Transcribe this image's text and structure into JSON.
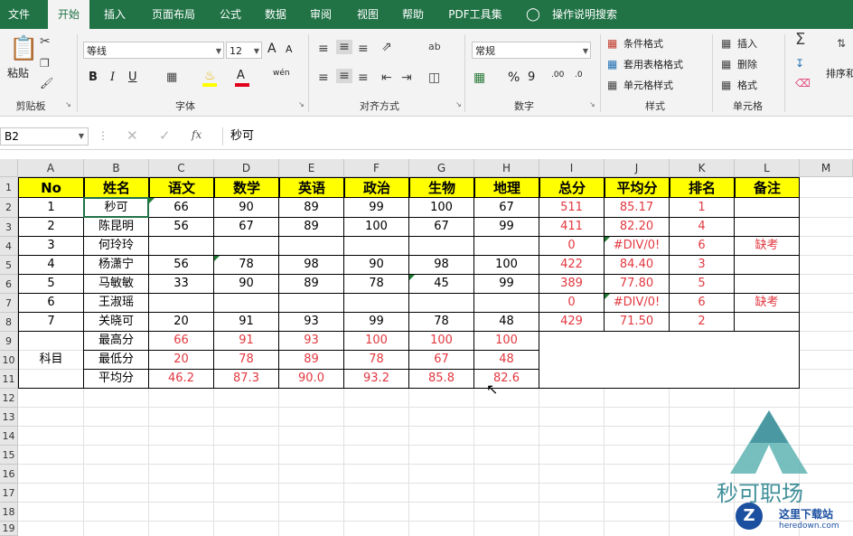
{
  "tabs": [
    {
      "label": "文件",
      "active": false
    },
    {
      "label": "开始",
      "active": true
    },
    {
      "label": "插入",
      "active": false
    },
    {
      "label": "页面布局",
      "active": false
    },
    {
      "label": "公式",
      "active": false
    },
    {
      "label": "数据",
      "active": false
    },
    {
      "label": "审阅",
      "active": false
    },
    {
      "label": "视图",
      "active": false
    },
    {
      "label": "帮助",
      "active": false
    },
    {
      "label": "PDF工具集",
      "active": false
    }
  ],
  "tell_me": "操作说明搜索",
  "ribbon": {
    "clipboard": {
      "label": "剪贴板",
      "paste": "粘贴"
    },
    "font": {
      "label": "字体",
      "font_name": "等线",
      "font_size": "12",
      "bold": "B",
      "italic": "I",
      "underline": "U",
      "grow": "A",
      "shrink": "A",
      "phonetic": "wén"
    },
    "alignment": {
      "label": "对齐方式"
    },
    "number": {
      "label": "数字",
      "format": "常规",
      "percent": "%",
      "comma": "9",
      "inc_decimal": ".00",
      "dec_decimal": ".0"
    },
    "styles": {
      "label": "样式",
      "conditional": "条件格式",
      "table": "套用表格格式",
      "cell_styles": "单元格样式"
    },
    "cells": {
      "label": "单元格",
      "insert": "插入",
      "delete": "删除",
      "format": "格式"
    },
    "editing": {
      "sort": "排序和"
    }
  },
  "formula_bar": {
    "name_box": "B2",
    "fx": "fx",
    "value": "秒可"
  },
  "columns": [
    "A",
    "B",
    "C",
    "D",
    "E",
    "F",
    "G",
    "H",
    "I",
    "J",
    "K",
    "L",
    "M"
  ],
  "rows": [
    "1",
    "2",
    "3",
    "4",
    "5",
    "6",
    "7",
    "8",
    "9",
    "10",
    "11",
    "12",
    "13",
    "14",
    "15",
    "16",
    "17",
    "18",
    "19"
  ],
  "table": {
    "header": [
      "No",
      "姓名",
      "语文",
      "数学",
      "英语",
      "政治",
      "生物",
      "地理",
      "总分",
      "平均分",
      "排名",
      "备注"
    ],
    "students": [
      [
        "1",
        "秒可",
        "66",
        "90",
        "89",
        "99",
        "100",
        "67",
        "511",
        "85.17",
        "1",
        ""
      ],
      [
        "2",
        "陈昆明",
        "56",
        "67",
        "89",
        "100",
        "67",
        "99",
        "411",
        "82.20",
        "4",
        ""
      ],
      [
        "3",
        "何玲玲",
        "",
        "",
        "",
        "",
        "",
        "",
        "0",
        "#DIV/0!",
        "6",
        "缺考"
      ],
      [
        "4",
        "杨潇宁",
        "56",
        "78",
        "98",
        "90",
        "98",
        "100",
        "422",
        "84.40",
        "3",
        ""
      ],
      [
        "5",
        "马敏敏",
        "33",
        "90",
        "89",
        "78",
        "45",
        "99",
        "389",
        "77.80",
        "5",
        ""
      ],
      [
        "6",
        "王淑瑶",
        "",
        "",
        "",
        "",
        "",
        "",
        "0",
        "#DIV/0!",
        "6",
        "缺考"
      ],
      [
        "7",
        "关晓可",
        "20",
        "91",
        "93",
        "99",
        "78",
        "48",
        "429",
        "71.50",
        "2",
        ""
      ]
    ],
    "subject_label": "科目",
    "stats": [
      {
        "label": "最高分",
        "values": [
          "66",
          "91",
          "93",
          "100",
          "100",
          "100"
        ]
      },
      {
        "label": "最低分",
        "values": [
          "20",
          "78",
          "89",
          "78",
          "67",
          "48"
        ]
      },
      {
        "label": "平均分",
        "values": [
          "46.2",
          "87.3",
          "90.0",
          "93.2",
          "85.8",
          "82.6"
        ]
      }
    ]
  },
  "watermark": {
    "brand": "秒可职场",
    "site_cn": "这里下载站",
    "site_url": "heredown.com"
  },
  "colors": {
    "excel_green": "#217346",
    "header_yellow": "#ffff00",
    "formula_red": "#e2383f"
  }
}
